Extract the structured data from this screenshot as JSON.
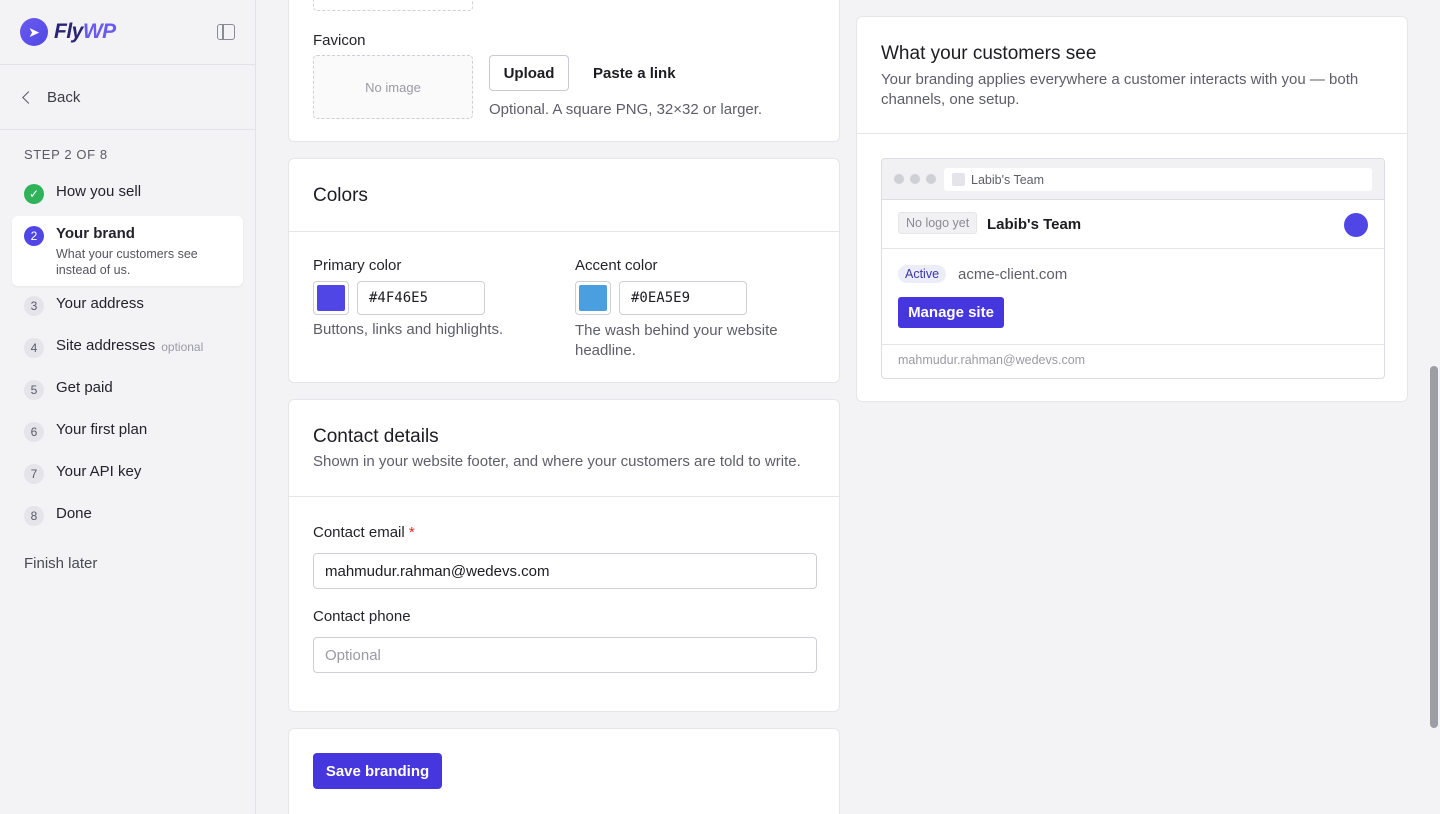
{
  "brand": {
    "name_a": "Fly",
    "name_b": "WP"
  },
  "sidebar": {
    "back_label": "Back",
    "step_counter": "STEP 2 OF 8",
    "steps": [
      {
        "num": "✓",
        "label": "How you sell",
        "status": "done"
      },
      {
        "num": "2",
        "label": "Your brand",
        "sub": "What your customers see instead of us.",
        "status": "current"
      },
      {
        "num": "3",
        "label": "Your address"
      },
      {
        "num": "4",
        "label": "Site addresses",
        "optional": "optional"
      },
      {
        "num": "5",
        "label": "Get paid"
      },
      {
        "num": "6",
        "label": "Your first plan"
      },
      {
        "num": "7",
        "label": "Your API key"
      },
      {
        "num": "8",
        "label": "Done"
      }
    ],
    "finish_later": "Finish later"
  },
  "favicon": {
    "label": "Favicon",
    "placeholder": "No image",
    "upload": "Upload",
    "paste": "Paste a link",
    "help": "Optional. A square PNG, 32×32 or larger."
  },
  "colors": {
    "title": "Colors",
    "primary": {
      "label": "Primary color",
      "value": "#4F46E5",
      "swatch": "#4f46e5",
      "help": "Buttons, links and highlights."
    },
    "accent": {
      "label": "Accent color",
      "value": "#0EA5E9",
      "swatch": "#4a9fe0",
      "help": "The wash behind your website headline."
    }
  },
  "contact": {
    "title": "Contact details",
    "subtitle": "Shown in your website footer, and where your customers are told to write.",
    "email_label": "Contact email",
    "required_mark": "*",
    "email_value": "mahmudur.rahman@wedevs.com",
    "phone_label": "Contact phone",
    "phone_placeholder": "Optional"
  },
  "save_label": "Save branding",
  "preview": {
    "title": "What your customers see",
    "subtitle": "Your branding applies everywhere a customer interacts with you — both channels, one setup.",
    "tab_title": "Labib's Team",
    "no_logo": "No logo yet",
    "team_name": "Labib's Team",
    "status": "Active",
    "domain": "acme-client.com",
    "manage": "Manage site",
    "footer_email": "mahmudur.rahman@wedevs.com"
  }
}
